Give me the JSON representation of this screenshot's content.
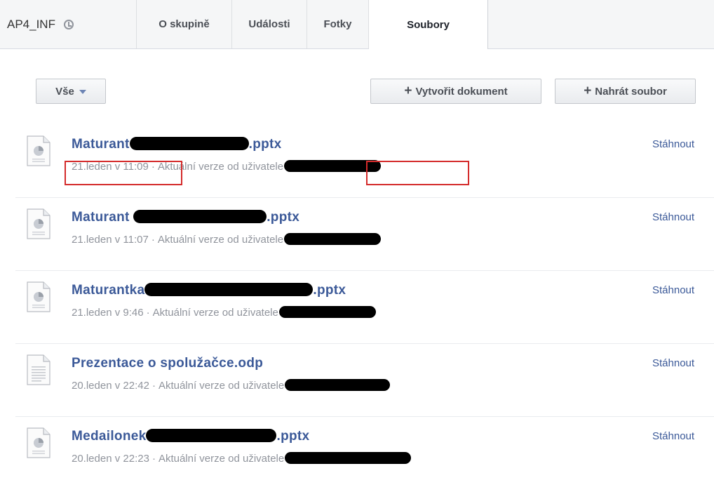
{
  "tabs": {
    "group_name": "AP4_INF",
    "items": [
      "O skupině",
      "Události",
      "Fotky",
      "Soubory"
    ],
    "active": "Soubory"
  },
  "toolbar": {
    "filter_label": "Vše",
    "create_label": "Vytvořit dokument",
    "upload_label": "Nahrát soubor"
  },
  "files": [
    {
      "name_prefix": "Maturant",
      "name_suffix": ".pptx",
      "date": "21.leden v 11:09",
      "version_text": "Aktuální verze od uživatele",
      "download": "Stáhnout",
      "icon": "presentation-file-icon",
      "highlighted": true
    },
    {
      "name_prefix": "Maturant",
      "name_suffix": ".pptx",
      "date": "21.leden v 11:07",
      "version_text": "Aktuální verze od uživatele",
      "download": "Stáhnout",
      "icon": "presentation-file-icon",
      "highlighted": false
    },
    {
      "name_prefix": "Maturantka",
      "name_suffix": ".pptx",
      "date": "21.leden v 9:46",
      "version_text": "Aktuální verze od uživatele",
      "download": "Stáhnout",
      "icon": "presentation-file-icon",
      "highlighted": false
    },
    {
      "name_prefix": "Prezentace o spolužačce.odp",
      "name_suffix": "",
      "date": "20.leden v 22:42",
      "version_text": "Aktuální verze od uživatele",
      "download": "Stáhnout",
      "icon": "document-file-icon",
      "highlighted": false
    },
    {
      "name_prefix": "Medailonek",
      "name_suffix": ".pptx",
      "date": "20.leden v 22:23",
      "version_text": "Aktuální verze od uživatele",
      "download": "Stáhnout",
      "icon": "presentation-file-icon",
      "highlighted": false
    }
  ],
  "colors": {
    "link": "#3b5998",
    "meta": "#90949c",
    "highlight": "#d42b2b",
    "redaction": "#000000"
  }
}
